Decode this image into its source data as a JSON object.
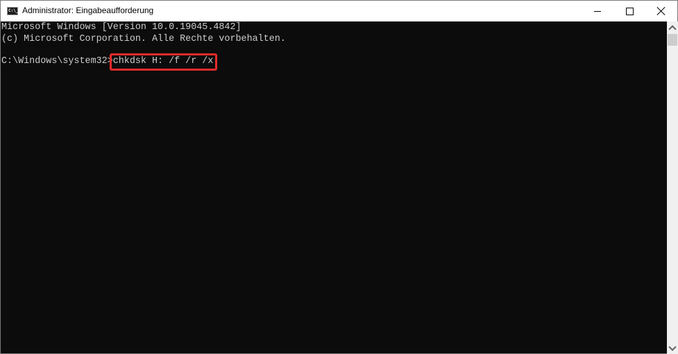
{
  "window": {
    "title": "Administrator: Eingabeaufforderung",
    "icon": "cmd-icon",
    "icon_text": "C:\\_",
    "controls": {
      "minimize": "minimize-icon",
      "maximize": "maximize-icon",
      "close": "close-icon"
    }
  },
  "console": {
    "lines": [
      "Microsoft Windows [Version 10.0.19045.4842]",
      "(c) Microsoft Corporation. Alle Rechte vorbehalten."
    ],
    "prompt": "C:\\Windows\\system32>",
    "command": "chkdsk H: /f /r /x",
    "highlight_color": "#e62b2b"
  },
  "scrollbar": {
    "up_icon": "chevron-up-icon",
    "down_icon": "chevron-down-icon",
    "position": 0
  }
}
